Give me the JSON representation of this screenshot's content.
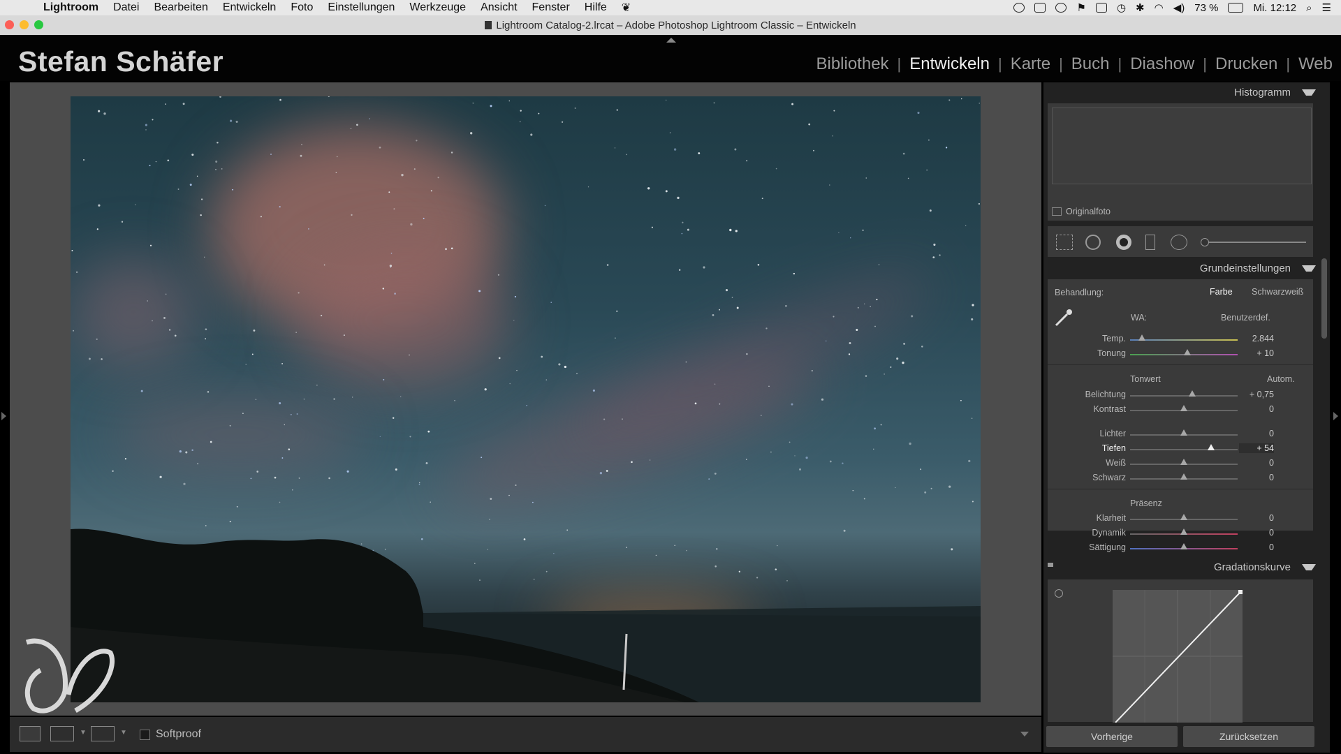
{
  "menubar": {
    "app": "Lightroom",
    "items": [
      "Datei",
      "Bearbeiten",
      "Entwickeln",
      "Foto",
      "Einstellungen",
      "Werkzeuge",
      "Ansicht",
      "Fenster",
      "Hilfe"
    ],
    "battery": "73 %",
    "clock": "Mi. 12:12"
  },
  "window": {
    "title": "Lightroom Catalog-2.lrcat – Adobe Photoshop Lightroom Classic – Entwickeln"
  },
  "identity": {
    "plate": "Stefan Schäfer",
    "modules": [
      "Bibliothek",
      "Entwickeln",
      "Karte",
      "Buch",
      "Diashow",
      "Drucken",
      "Web"
    ],
    "active_module": "Entwickeln"
  },
  "toolbar": {
    "softproof": "Softproof"
  },
  "panels": {
    "histogram": {
      "title": "Histogramm",
      "original_photo": "Originalfoto"
    },
    "basic": {
      "title": "Grundeinstellungen",
      "treatment_label": "Behandlung:",
      "treatment_color": "Farbe",
      "treatment_bw": "Schwarzweiß",
      "wb_label": "WA:",
      "wb_value": "Benutzerdef.",
      "temp": {
        "label": "Temp.",
        "value": "2.844",
        "pos": 0.11
      },
      "tint": {
        "label": "Tonung",
        "value": "+ 10",
        "pos": 0.53
      },
      "tone_header": "Tonwert",
      "auto": "Autom.",
      "sliders_tone": [
        {
          "label": "Belichtung",
          "value": "+ 0,75",
          "pos": 0.575
        },
        {
          "label": "Kontrast",
          "value": "0",
          "pos": 0.5
        }
      ],
      "sliders_tone2": [
        {
          "label": "Lichter",
          "value": "0",
          "pos": 0.5
        },
        {
          "label": "Tiefen",
          "value": "+ 54",
          "pos": 0.75,
          "active": true
        },
        {
          "label": "Weiß",
          "value": "0",
          "pos": 0.5
        },
        {
          "label": "Schwarz",
          "value": "0",
          "pos": 0.5
        }
      ],
      "presence_header": "Präsenz",
      "sliders_presence": [
        {
          "label": "Klarheit",
          "value": "0",
          "pos": 0.5
        },
        {
          "label": "Dynamik",
          "value": "0",
          "pos": 0.5
        },
        {
          "label": "Sättigung",
          "value": "0",
          "pos": 0.5
        }
      ]
    },
    "tone_curve": {
      "title": "Gradationskurve"
    }
  },
  "footer": {
    "previous": "Vorherige",
    "reset": "Zurücksetzen"
  },
  "colors": {
    "accent_active": "#f0f0f0",
    "panel_bg": "#3a3a3a",
    "sky_top": "#1e3a44",
    "cloud_pink": "#9a6a68"
  }
}
